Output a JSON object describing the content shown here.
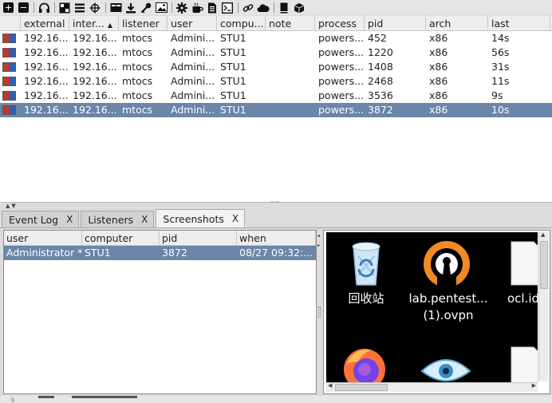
{
  "toolbar": {
    "icons": [
      "new-connection-icon",
      "disconnect-icon",
      "headphones-icon",
      "targets-icon",
      "list-icon",
      "crosshair-icon",
      "console-icon",
      "download-icon",
      "key-icon",
      "screenshot-icon",
      "settings-icon",
      "coffee-icon",
      "document-icon",
      "terminal-icon",
      "link-icon",
      "cloud-icon",
      "book-icon",
      "package-icon"
    ]
  },
  "sessions": {
    "columns": [
      "external",
      "inter...",
      "listener",
      "user",
      "compu...",
      "note",
      "process",
      "pid",
      "arch",
      "last"
    ],
    "sort_indicator": "▲",
    "rows": [
      {
        "external": "192.16...",
        "internal": "192.16...",
        "listener": "mtocs",
        "user": "Admini...",
        "computer": "STU1",
        "note": "",
        "process": "powers...",
        "pid": "452",
        "arch": "x86",
        "last": "14s"
      },
      {
        "external": "192.16...",
        "internal": "192.16...",
        "listener": "mtocs",
        "user": "Admini...",
        "computer": "STU1",
        "note": "",
        "process": "powers...",
        "pid": "1220",
        "arch": "x86",
        "last": "56s"
      },
      {
        "external": "192.16...",
        "internal": "192.16...",
        "listener": "mtocs",
        "user": "Admini...",
        "computer": "STU1",
        "note": "",
        "process": "powers...",
        "pid": "1408",
        "arch": "x86",
        "last": "31s"
      },
      {
        "external": "192.16...",
        "internal": "192.16...",
        "listener": "mtocs",
        "user": "Admini...",
        "computer": "STU1",
        "note": "",
        "process": "powers...",
        "pid": "2468",
        "arch": "x86",
        "last": "11s"
      },
      {
        "external": "192.16...",
        "internal": "192.16...",
        "listener": "mtocs",
        "user": "Admini...",
        "computer": "STU1",
        "note": "",
        "process": "powers...",
        "pid": "3536",
        "arch": "x86",
        "last": "9s"
      },
      {
        "external": "192.16...",
        "internal": "192.16...",
        "listener": "mtocs",
        "user": "Admini...",
        "computer": "STU1",
        "note": "",
        "process": "powers...",
        "pid": "3872",
        "arch": "x86",
        "last": "10s"
      }
    ],
    "selected_row": 5
  },
  "tabs": [
    {
      "label": "Event Log",
      "close": "X"
    },
    {
      "label": "Listeners",
      "close": "X"
    },
    {
      "label": "Screenshots",
      "close": "X"
    }
  ],
  "screenshots": {
    "columns": [
      "user",
      "computer",
      "pid",
      "when"
    ],
    "row": {
      "user": "Administrator *",
      "computer": "STU1",
      "pid": "3872",
      "when": "08/27 09:32:..."
    }
  },
  "desktop": {
    "icons": [
      {
        "label": "回收站"
      },
      {
        "label_line1": "lab.pentest...",
        "label_line2": "(1).ovpn"
      },
      {
        "label": "ocl.id"
      }
    ]
  },
  "colors": {
    "selection": "#6a86a8",
    "desktop_bg": "#000000",
    "openvpn_orange": "#f08a24"
  }
}
